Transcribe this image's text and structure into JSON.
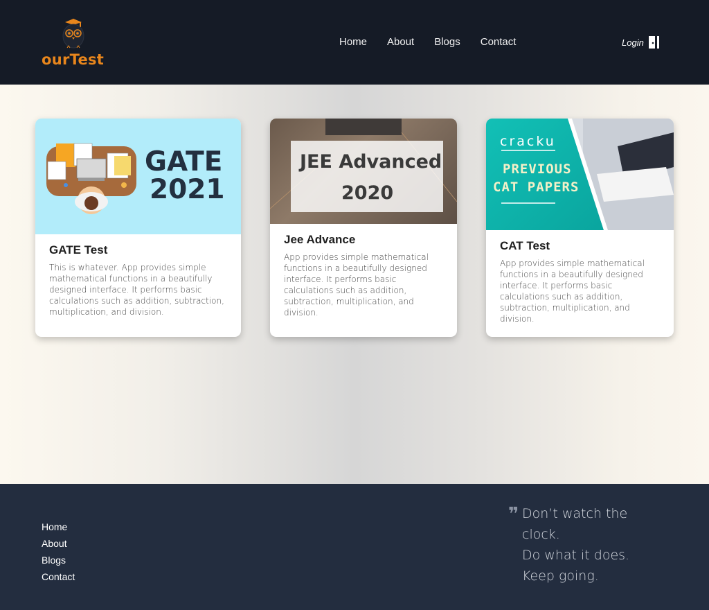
{
  "header": {
    "brand": "ourTest",
    "nav": [
      "Home",
      "About",
      "Blogs",
      "Contact"
    ],
    "login_label": "Login"
  },
  "cards": [
    {
      "title": "GATE Test",
      "text": "This is whatever. App provides simple mathematical functions in a beautifully designed interface. It performs basic calculations such as addition, subtraction, multiplication, and division.",
      "image_text": [
        "GATE",
        "2021"
      ]
    },
    {
      "title": "Jee Advance",
      "text": "App provides simple mathematical functions in a beautifully designed interface. It performs basic calculations such as addition, subtraction, multiplication, and division.",
      "image_text": [
        "JEE Advanced",
        "2020"
      ]
    },
    {
      "title": "CAT Test",
      "text": "App provides simple mathematical functions in a beautifully designed interface. It performs basic calculations such as addition, subtraction, multiplication, and division.",
      "image_text": [
        "cracku",
        "PREVIOUS",
        "CAT PAPERS"
      ]
    }
  ],
  "footer": {
    "links": [
      "Home",
      "About",
      "Blogs",
      "Contact"
    ],
    "quote_lines": [
      "Don’t watch the",
      "clock.",
      "Do what it does.",
      "Keep going."
    ]
  },
  "colors": {
    "header_bg": "#151b26",
    "footer_bg": "#232d3f",
    "brand_orange": "#e8861c"
  }
}
